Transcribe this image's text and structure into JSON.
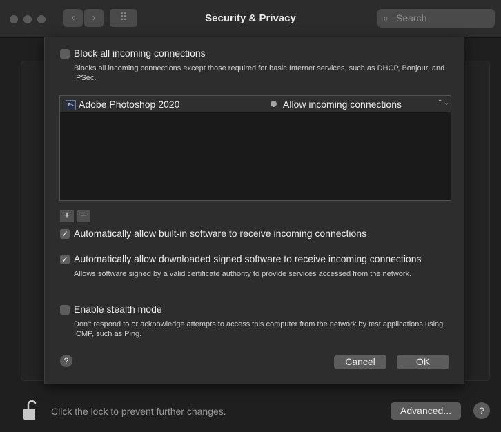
{
  "window": {
    "title": "Security & Privacy",
    "back_glyph": "‹",
    "forward_glyph": "›",
    "grid_glyph": "⠿",
    "search_placeholder": "Search",
    "search_glyph": "⌕"
  },
  "firewall_options": {
    "block_all": {
      "label": "Block all incoming connections",
      "checked": false,
      "description": "Blocks all incoming connections except those required for basic Internet services, such as DHCP, Bonjour, and IPSec."
    },
    "apps": [
      {
        "icon_text": "Ps",
        "name": "Adobe Photoshop 2020",
        "status": "Allow incoming connections",
        "popup_glyph": "⌃⌄"
      }
    ],
    "add_label": "+",
    "remove_label": "−",
    "auto_builtin": {
      "label": "Automatically allow built-in software to receive incoming connections",
      "checked": true,
      "check_glyph": "✓"
    },
    "auto_signed": {
      "label": "Automatically allow downloaded signed software to receive incoming connections",
      "checked": true,
      "check_glyph": "✓",
      "description": "Allows software signed by a valid certificate authority to provide services accessed from the network."
    },
    "stealth": {
      "label": "Enable stealth mode",
      "checked": false,
      "description": "Don't respond to or acknowledge attempts to access this computer from the network by test applications using ICMP, such as Ping."
    },
    "help_label": "?",
    "cancel_label": "Cancel",
    "ok_label": "OK"
  },
  "footer": {
    "lock_message": "Click the lock to prevent further changes.",
    "advanced_label": "Advanced...",
    "help_label": "?"
  },
  "colors": {
    "background": "#1f1f1f",
    "sheet": "#2d2d2d",
    "list": "#1a1a1a",
    "button": "#5c5c5c"
  }
}
